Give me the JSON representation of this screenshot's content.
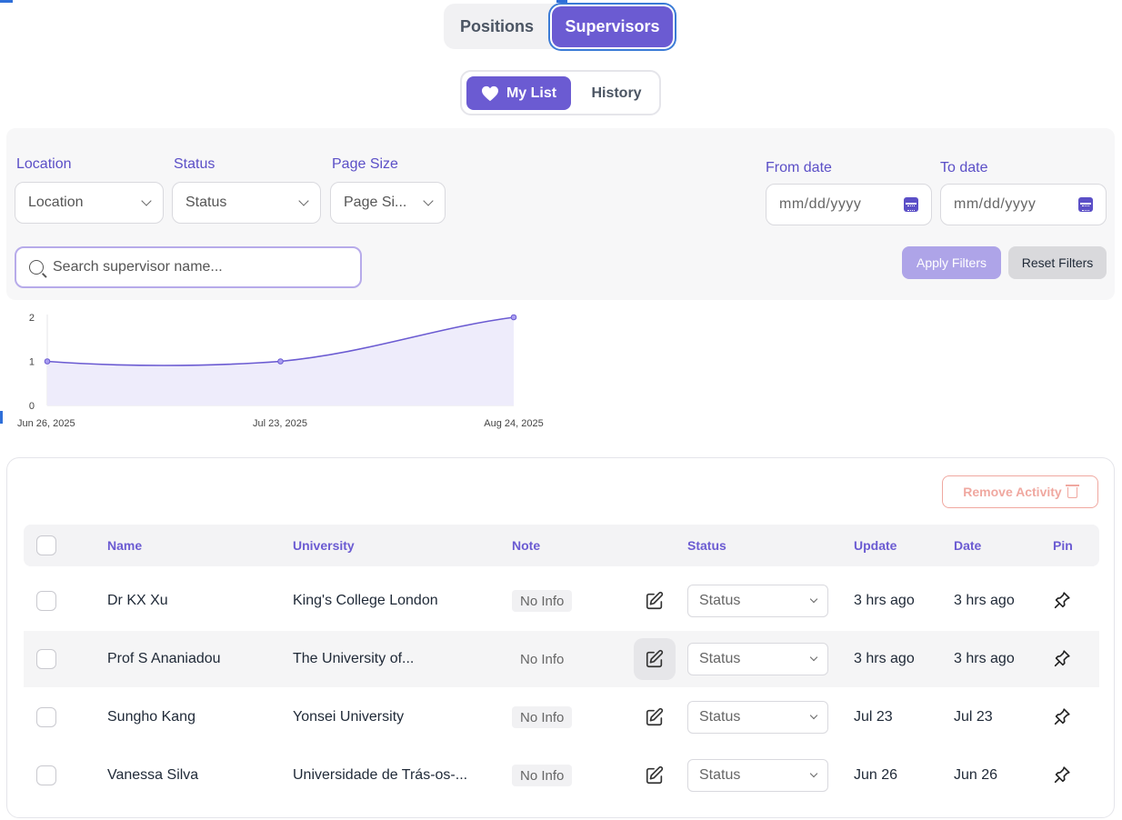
{
  "top_tabs": {
    "positions": "Positions",
    "supervisors": "Supervisors"
  },
  "sub_tabs": {
    "my_list": "My List",
    "history": "History"
  },
  "filters": {
    "location_label": "Location",
    "location_value": "Location",
    "status_label": "Status",
    "status_value": "Status",
    "page_size_label": "Page Size",
    "page_size_value": "Page Si...",
    "from_label": "From date",
    "from_value": "mm/dd/yyyy",
    "to_label": "To date",
    "to_value": "mm/dd/yyyy",
    "search_placeholder": "Search supervisor name...",
    "apply": "Apply Filters",
    "reset": "Reset Filters"
  },
  "colors": {
    "accent": "#6b5bd2",
    "accent_light": "#aea4e8",
    "danger_light": "#f0a8a0"
  },
  "chart_data": {
    "type": "area",
    "x": [
      "Jun 26, 2025",
      "Jul 23, 2025",
      "Aug 24, 2025"
    ],
    "values": [
      1,
      1,
      2
    ],
    "yticks": [
      "0",
      "1",
      "2"
    ],
    "ylim": [
      0,
      2
    ],
    "grid": false,
    "title": "",
    "xlabel": "",
    "ylabel": ""
  },
  "table": {
    "remove_label": "Remove Activity",
    "headers": {
      "name": "Name",
      "university": "University",
      "note": "Note",
      "status": "Status",
      "update": "Update",
      "date": "Date",
      "pin": "Pin"
    },
    "rows": [
      {
        "name": "Dr KX Xu",
        "university": "King's College London",
        "note": "No Info",
        "status": "Status",
        "update": "3 hrs ago",
        "date": "3 hrs ago"
      },
      {
        "name": "Prof S Ananiadou",
        "university": "The University of...",
        "note": "No Info",
        "status": "Status",
        "update": "3 hrs ago",
        "date": "3 hrs ago"
      },
      {
        "name": "Sungho Kang",
        "university": "Yonsei University",
        "note": "No Info",
        "status": "Status",
        "update": "Jul 23",
        "date": "Jul 23"
      },
      {
        "name": "Vanessa Silva",
        "university": "Universidade de Trás-os-...",
        "note": "No Info",
        "status": "Status",
        "update": "Jun 26",
        "date": "Jun 26"
      }
    ]
  }
}
